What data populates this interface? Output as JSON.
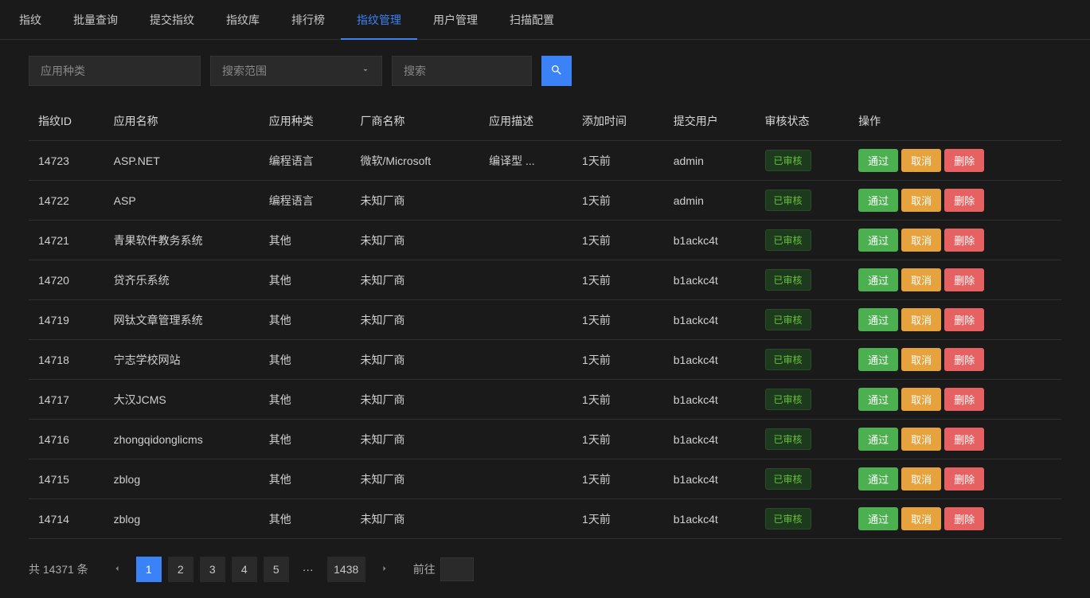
{
  "nav": {
    "items": [
      {
        "label": "指纹",
        "active": false
      },
      {
        "label": "批量查询",
        "active": false
      },
      {
        "label": "提交指纹",
        "active": false
      },
      {
        "label": "指纹库",
        "active": false
      },
      {
        "label": "排行榜",
        "active": false
      },
      {
        "label": "指纹管理",
        "active": true
      },
      {
        "label": "用户管理",
        "active": false
      },
      {
        "label": "扫描配置",
        "active": false
      }
    ]
  },
  "filters": {
    "category_placeholder": "应用种类",
    "scope_placeholder": "搜索范围",
    "search_placeholder": "搜索"
  },
  "table": {
    "headers": [
      "指纹ID",
      "应用名称",
      "应用种类",
      "厂商名称",
      "应用描述",
      "添加时间",
      "提交用户",
      "审核状态",
      "操作"
    ],
    "status_label": "已审核",
    "action_labels": {
      "pass": "通过",
      "cancel": "取消",
      "delete": "删除"
    },
    "rows": [
      {
        "id": "14723",
        "name": "ASP.NET",
        "category": "编程语言",
        "vendor": "微软/Microsoft",
        "desc": "编译型 ...",
        "added": "1天前",
        "user": "admin"
      },
      {
        "id": "14722",
        "name": "ASP",
        "category": "编程语言",
        "vendor": "未知厂商",
        "desc": "",
        "added": "1天前",
        "user": "admin"
      },
      {
        "id": "14721",
        "name": "青果软件教务系统",
        "category": "其他",
        "vendor": "未知厂商",
        "desc": "",
        "added": "1天前",
        "user": "b1ackc4t"
      },
      {
        "id": "14720",
        "name": "贷齐乐系统",
        "category": "其他",
        "vendor": "未知厂商",
        "desc": "",
        "added": "1天前",
        "user": "b1ackc4t"
      },
      {
        "id": "14719",
        "name": "网钛文章管理系统",
        "category": "其他",
        "vendor": "未知厂商",
        "desc": "",
        "added": "1天前",
        "user": "b1ackc4t"
      },
      {
        "id": "14718",
        "name": "宁志学校网站",
        "category": "其他",
        "vendor": "未知厂商",
        "desc": "",
        "added": "1天前",
        "user": "b1ackc4t"
      },
      {
        "id": "14717",
        "name": "大汉JCMS",
        "category": "其他",
        "vendor": "未知厂商",
        "desc": "",
        "added": "1天前",
        "user": "b1ackc4t"
      },
      {
        "id": "14716",
        "name": "zhongqidonglicms",
        "category": "其他",
        "vendor": "未知厂商",
        "desc": "",
        "added": "1天前",
        "user": "b1ackc4t"
      },
      {
        "id": "14715",
        "name": "zblog",
        "category": "其他",
        "vendor": "未知厂商",
        "desc": "",
        "added": "1天前",
        "user": "b1ackc4t"
      },
      {
        "id": "14714",
        "name": "zblog",
        "category": "其他",
        "vendor": "未知厂商",
        "desc": "",
        "added": "1天前",
        "user": "b1ackc4t"
      }
    ]
  },
  "pager": {
    "total_prefix": "共",
    "total_count": "14371",
    "total_suffix": "条",
    "pages": [
      "1",
      "2",
      "3",
      "4",
      "5"
    ],
    "ellipsis": "···",
    "last": "1438",
    "jump_label": "前往"
  }
}
